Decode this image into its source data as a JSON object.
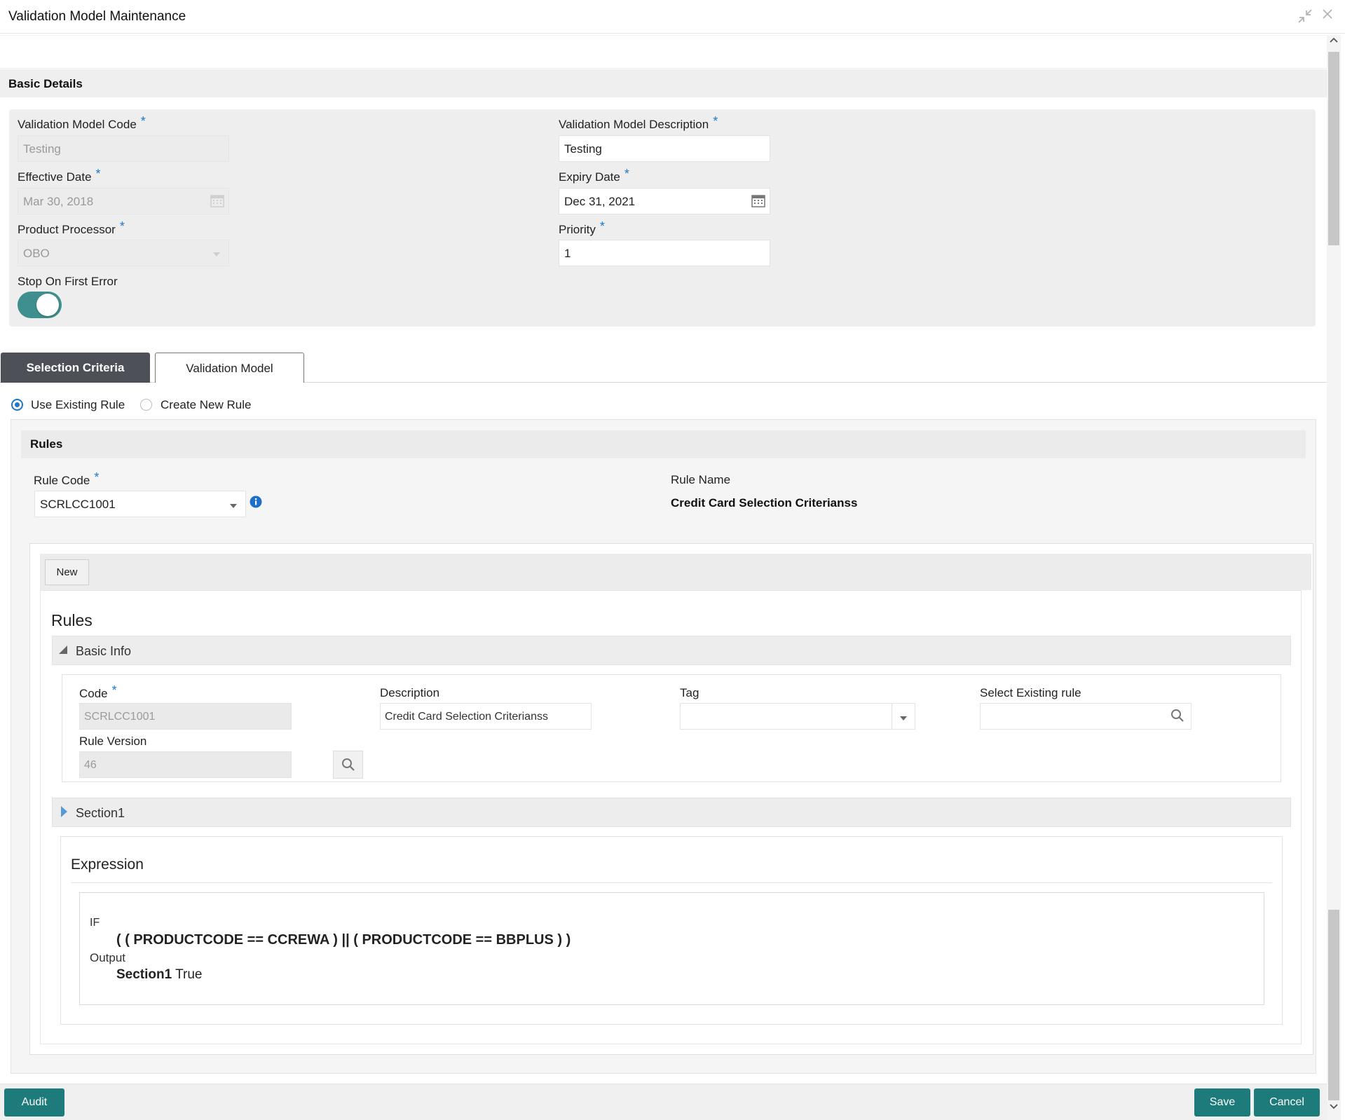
{
  "window": {
    "title": "Validation Model Maintenance"
  },
  "basic_details": {
    "title": "Basic Details",
    "validation_model_code": {
      "label": "Validation Model Code",
      "value": "Testing"
    },
    "validation_model_description": {
      "label": "Validation Model Description",
      "value": "Testing"
    },
    "effective_date": {
      "label": "Effective Date",
      "value": "Mar 30, 2018"
    },
    "expiry_date": {
      "label": "Expiry Date",
      "value": "Dec 31, 2021"
    },
    "product_processor": {
      "label": "Product Processor",
      "value": "OBO"
    },
    "priority": {
      "label": "Priority",
      "value": "1"
    },
    "stop_on_first_error": {
      "label": "Stop On First Error",
      "on": true
    },
    "required_mark": "*"
  },
  "tabs": [
    {
      "label": "Selection Criteria",
      "selected": true
    },
    {
      "label": "Validation Model",
      "selected": false
    }
  ],
  "rule_mode": {
    "options": [
      {
        "label": "Use Existing Rule",
        "selected": true
      },
      {
        "label": "Create New Rule",
        "selected": false
      }
    ]
  },
  "rules": {
    "title": "Rules",
    "rule_code": {
      "label": "Rule Code",
      "value": "SCRLCC1001"
    },
    "rule_name": {
      "label": "Rule Name",
      "value": "Credit Card Selection Criterianss"
    },
    "new_button": "New",
    "inner_title": "Rules",
    "basic_info": {
      "label": "Basic Info",
      "code": {
        "label": "Code",
        "value": "SCRLCC1001"
      },
      "description": {
        "label": "Description",
        "value": "Credit Card Selection Criterianss"
      },
      "tag": {
        "label": "Tag",
        "value": ""
      },
      "select_existing_rule": {
        "label": "Select Existing rule",
        "value": ""
      },
      "rule_version": {
        "label": "Rule Version",
        "value": "46"
      }
    },
    "section": {
      "label": "Section1"
    },
    "expression": {
      "title": "Expression",
      "if_label": "IF",
      "condition": "( ( PRODUCTCODE == CCREWA ) || ( PRODUCTCODE == BBPLUS ) )",
      "output_label": "Output",
      "output_name": "Section1",
      "output_value": "True"
    }
  },
  "footer": {
    "audit": "Audit",
    "save": "Save",
    "cancel": "Cancel"
  },
  "colors": {
    "accent": "#1e7b7b",
    "toggle": "#3f8f8f",
    "tab_selected": "#4d5157",
    "required": "#1f78c8"
  }
}
